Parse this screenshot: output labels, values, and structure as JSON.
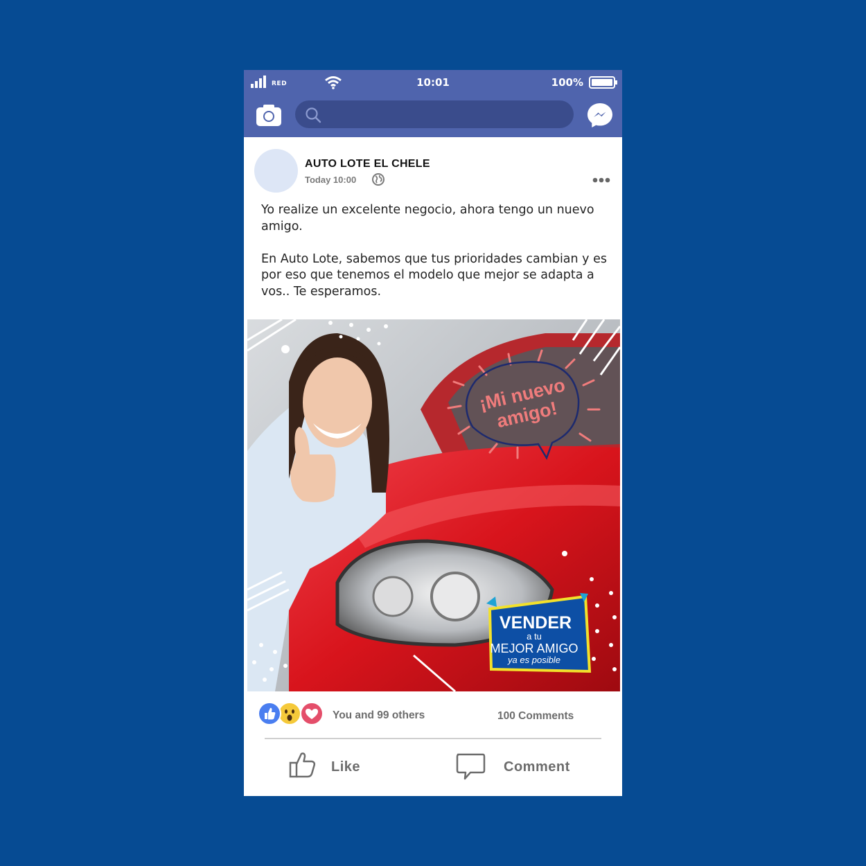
{
  "status_bar": {
    "carrier": "RED",
    "time": "10:01",
    "battery": "100%"
  },
  "nav": {
    "icons": [
      "camera-icon",
      "search-icon",
      "messenger-icon"
    ],
    "search_placeholder": ""
  },
  "post": {
    "page_name": "AUTO LOTE EL CHELE",
    "time": "Today 10:00",
    "text_paragraphs": [
      "Yo realize un excelente negocio, ahora tengo un nuevo amigo.",
      "En Auto Lote, sabemos que tus prioridades cambian y es por eso que tenemos el modelo que mejor se adapta a vos.. Te esperamos."
    ],
    "image": {
      "bubble_line1": "¡Mi nuevo",
      "bubble_line2": "amigo!",
      "badge_vender": "VENDER",
      "badge_atu": "a tu",
      "badge_mejor": "MEJOR AMIGO",
      "badge_posible": "ya es posible"
    }
  },
  "footer": {
    "reactions": [
      "like-icon",
      "wow-icon",
      "love-icon"
    ],
    "reaction_text": "You and 99 others",
    "comments": "100 Comments",
    "like_label": "Like",
    "comment_label": "Comment"
  },
  "colors": {
    "background": "#064b93",
    "bar": "#4f64ad",
    "search": "#3a4c8c",
    "car_red": "#d8141c",
    "bubble_text": "#f07c7c",
    "badge_blue": "#0d4fa5",
    "badge_border": "#f2e12b"
  }
}
